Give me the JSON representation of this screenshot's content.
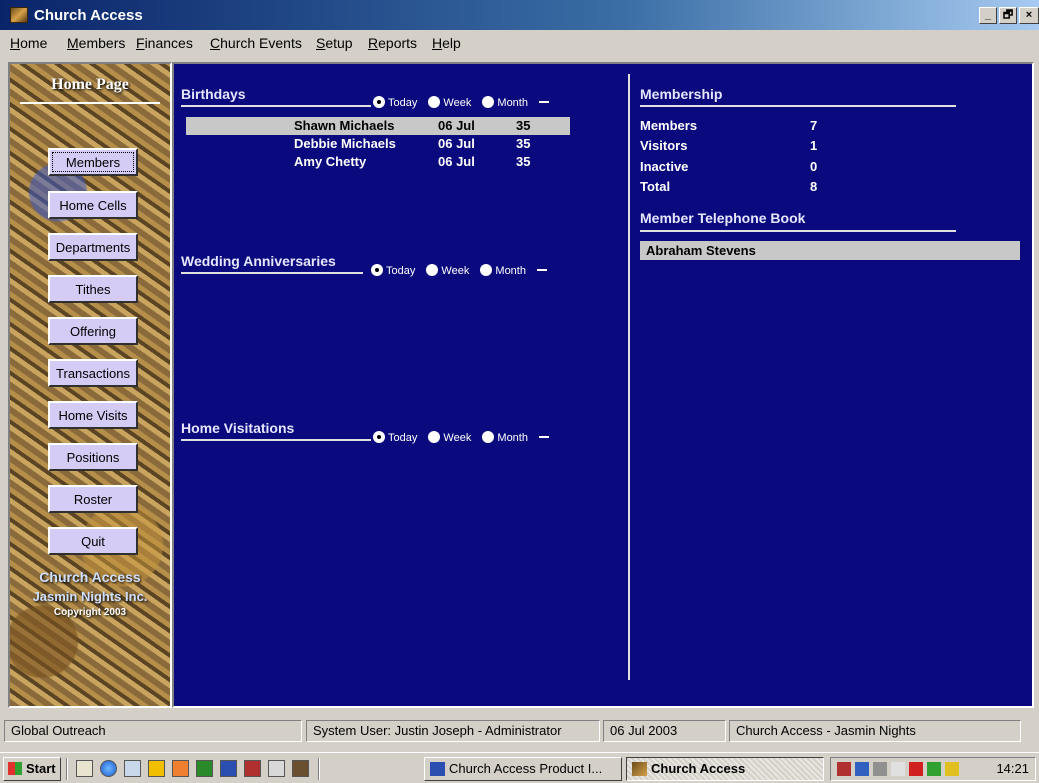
{
  "window": {
    "title": "Church Access",
    "controls": {
      "minimize": "_",
      "maximize": "🗗",
      "close": "×"
    }
  },
  "menu": {
    "items": [
      {
        "label": "Home",
        "underline": "H",
        "rest": "ome"
      },
      {
        "label": "Members",
        "underline": "M",
        "rest": "embers"
      },
      {
        "label": "Finances",
        "underline": "F",
        "rest": "inances"
      },
      {
        "label": "Church Events",
        "underline": "C",
        "rest": "hurch Events"
      },
      {
        "label": "Setup",
        "underline": "S",
        "rest": "etup"
      },
      {
        "label": "Reports",
        "underline": "R",
        "rest": "eports"
      },
      {
        "label": "Help",
        "underline": "H",
        "rest": "elp"
      }
    ]
  },
  "sidebar": {
    "title": "Home Page",
    "buttons": [
      "Members",
      "Home Cells",
      "Departments",
      "Tithes",
      "Offering",
      "Transactions",
      "Home Visits",
      "Positions",
      "Roster",
      "Quit"
    ],
    "brand_name": "Church Access",
    "brand_company": "Jasmin Nights Inc.",
    "copyright": "Copyright 2003"
  },
  "birthdays": {
    "title": "Birthdays",
    "options": {
      "today": "Today",
      "week": "Week",
      "month": "Month"
    },
    "selected": "today",
    "rows": [
      {
        "name": "Shawn Michaels",
        "date": "06 Jul",
        "age": "35"
      },
      {
        "name": "Debbie Michaels",
        "date": "06 Jul",
        "age": "35"
      },
      {
        "name": "Amy Chetty",
        "date": "06 Jul",
        "age": "35"
      }
    ]
  },
  "anniversaries": {
    "title": "Wedding Anniversaries",
    "options": {
      "today": "Today",
      "week": "Week",
      "month": "Month"
    },
    "selected": "today"
  },
  "visitations": {
    "title": "Home Visitations",
    "options": {
      "today": "Today",
      "week": "Week",
      "month": "Month"
    },
    "selected": "today"
  },
  "membership": {
    "title": "Membership",
    "stats": [
      {
        "label": "Members",
        "value": "7"
      },
      {
        "label": "Visitors",
        "value": "1"
      },
      {
        "label": "Inactive",
        "value": "0"
      },
      {
        "label": "Total",
        "value": "8"
      }
    ]
  },
  "phonebook": {
    "title": "Member Telephone Book",
    "entries": [
      "Abraham Stevens"
    ]
  },
  "status": {
    "organization": "Global Outreach",
    "user": "System User: Justin Joseph - Administrator",
    "date": "06 Jul 2003",
    "product": "Church Access - Jasmin Nights"
  },
  "taskbar": {
    "start_label": "Start",
    "tasks": [
      {
        "label": "Church Access Product I...",
        "active": false
      },
      {
        "label": "Church Access",
        "active": true
      }
    ],
    "clock": "14:21",
    "colors": {
      "accent": "#0a0a7e",
      "panel": "#d4d0c8",
      "button": "#d4ccf4"
    }
  }
}
